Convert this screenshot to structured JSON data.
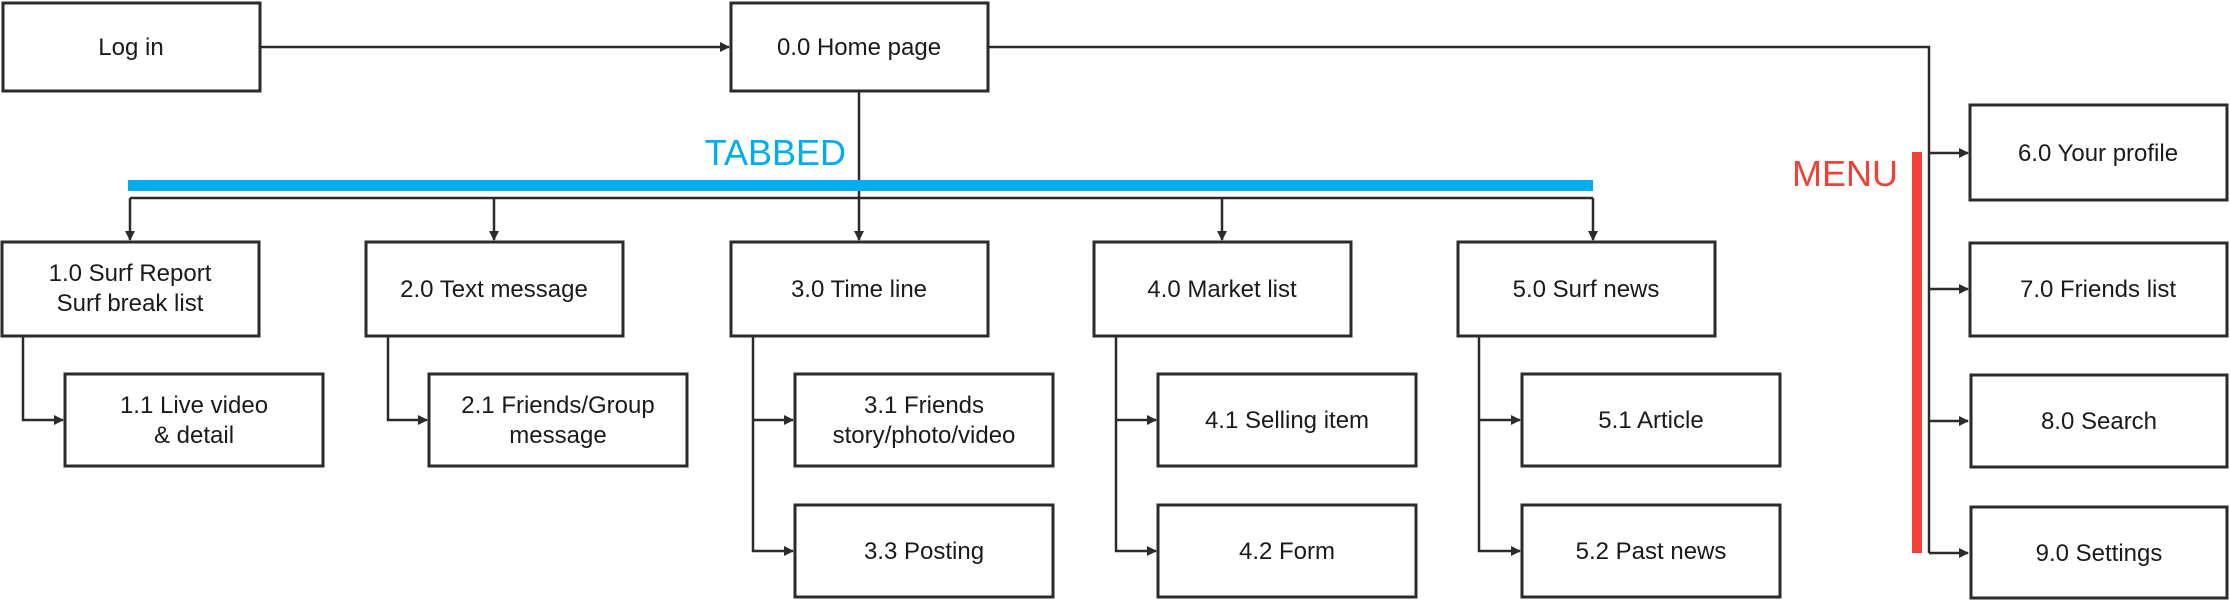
{
  "colors": {
    "tabbed": "#00AEEF",
    "menu": "#EF4136",
    "box_stroke": "#2b2b2b"
  },
  "labels": {
    "tabbed": "TABBED",
    "menu": "MENU"
  },
  "nodes": {
    "login": [
      "Log in"
    ],
    "home": [
      "0.0 Home page"
    ],
    "n1_0": [
      "1.0 Surf Report",
      "Surf break list"
    ],
    "n1_1": [
      "1.1 Live video",
      "& detail"
    ],
    "n2_0": [
      "2.0 Text message"
    ],
    "n2_1": [
      "2.1 Friends/Group",
      "message"
    ],
    "n3_0": [
      "3.0 Time line"
    ],
    "n3_1": [
      "3.1 Friends",
      "story/photo/video"
    ],
    "n3_3": [
      "3.3 Posting"
    ],
    "n4_0": [
      "4.0 Market list"
    ],
    "n4_1": [
      "4.1 Selling item"
    ],
    "n4_2": [
      "4.2 Form"
    ],
    "n5_0": [
      "5.0 Surf news"
    ],
    "n5_1": [
      "5.1 Article"
    ],
    "n5_2": [
      "5.2 Past news"
    ],
    "n6_0": [
      "6.0 Your profile"
    ],
    "n7_0": [
      "7.0 Friends list"
    ],
    "n8_0": [
      "8.0 Search"
    ],
    "n9_0": [
      "9.0 Settings"
    ]
  }
}
